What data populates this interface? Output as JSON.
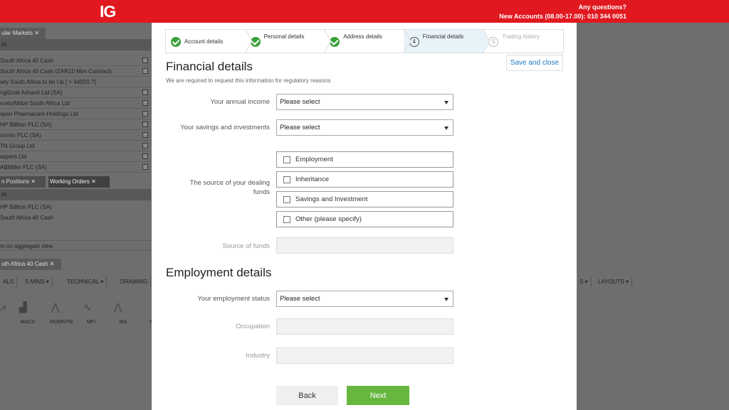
{
  "header": {
    "logo": "IG",
    "any_questions": "Any questions?",
    "new_accounts": "New Accounts (08.00-17.00): 010 344 0051"
  },
  "background": {
    "tabs": [
      "ular Markets",
      "n Positions",
      "Working Orders",
      "uth Africa 40 Cash"
    ],
    "markets_header": "et",
    "markets": [
      "South Africa 40 Cash",
      "South Africa 40 Cash (ZAR10 Mini Contract)",
      "aily South Africa to be Up [ > 44920.7]",
      "nglGold Ashanti Ltd (SA)",
      "rcelorMittal South Africa Ltd",
      "spen Pharmacare Holdings Ltd",
      "HP Billiton PLC (SA)",
      "onmin PLC (SA)",
      "TN Group Ltd",
      "aspers Ltd",
      "ABMiller PLC (SA)"
    ],
    "positions_header": "et",
    "positions": [
      "HP Billiton PLC (SA)",
      "South Africa 40 Cash"
    ],
    "aggregate": "m on aggregate view",
    "toolbar": [
      "ALS",
      "5 MINS",
      "TECHNICAL",
      "DRAWING",
      "S",
      "LAYOUTS"
    ],
    "indicators": [
      "MACD",
      "MOMNTM",
      "MFI",
      "MA",
      "S"
    ]
  },
  "stepper": {
    "steps": [
      {
        "num": "",
        "label": "Account details",
        "state": "done"
      },
      {
        "num": "",
        "label": "Personal details",
        "state": "done"
      },
      {
        "num": "",
        "label": "Address details",
        "state": "done"
      },
      {
        "num": "4",
        "label": "Financial details",
        "state": "current"
      },
      {
        "num": "5",
        "label": "Trading history",
        "state": "future"
      }
    ]
  },
  "save_close": "Save and close",
  "financial": {
    "title": "Financial details",
    "subtitle": "We are required to request this information for regulatory reasons",
    "annual_income_label": "Your annual income",
    "annual_income_value": "Please select",
    "savings_label": "Your savings and investments",
    "savings_value": "Please select",
    "source_label": "The source of your dealing funds",
    "sources": [
      "Employment",
      "Inheritance",
      "Savings and Investment",
      "Other (please specify)"
    ],
    "source_of_funds_label": "Source of funds"
  },
  "employment": {
    "title": "Employment details",
    "status_label": "Your employment status",
    "status_value": "Please select",
    "occupation_label": "Occupation",
    "industry_label": "Industry"
  },
  "buttons": {
    "back": "Back",
    "next": "Next"
  }
}
